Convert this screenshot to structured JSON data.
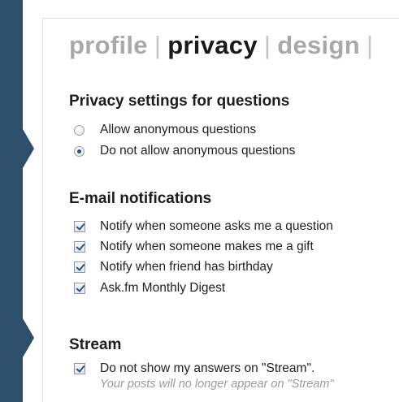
{
  "tabs": [
    {
      "label": "profile",
      "active": false
    },
    {
      "label": "privacy",
      "active": true
    },
    {
      "label": "design",
      "active": false
    }
  ],
  "tab_separator": "|",
  "privacy_section": {
    "heading": "Privacy settings for questions",
    "options": [
      {
        "label": "Allow anonymous questions",
        "selected": false
      },
      {
        "label": "Do not allow anonymous questions",
        "selected": true
      }
    ]
  },
  "email_section": {
    "heading": "E-mail notifications",
    "options": [
      {
        "label": "Notify when someone asks me a question",
        "checked": true
      },
      {
        "label": "Notify when someone makes me a gift",
        "checked": true
      },
      {
        "label": "Notify when friend has birthday",
        "checked": true
      },
      {
        "label": "Ask.fm Monthly Digest",
        "checked": true
      }
    ]
  },
  "stream_section": {
    "heading": "Stream",
    "option": {
      "label": "Do not show my answers on \"Stream\".",
      "checked": true
    },
    "hint": "Your posts will no longer appear on \"Stream\""
  },
  "colors": {
    "sidebar": "#2c4f6c",
    "active_tab": "#1a1a1a",
    "inactive_tab": "#a9a9a9",
    "check_mark": "#2f4f8e"
  }
}
